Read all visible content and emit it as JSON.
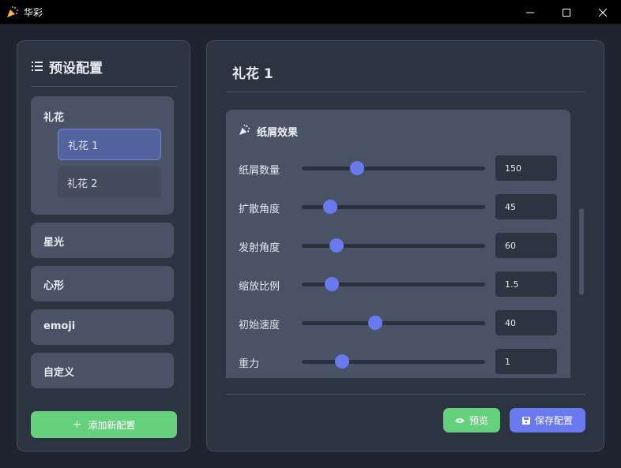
{
  "window": {
    "title": "华彩",
    "icon": "party-popper-icon",
    "controls": [
      "minimize-icon",
      "maximize-icon",
      "close-icon"
    ]
  },
  "sidebar": {
    "title": "预设配置",
    "groups": [
      {
        "label": "礼花",
        "items": [
          {
            "label": "礼花 1",
            "active": true
          },
          {
            "label": "礼花 2",
            "active": false
          }
        ]
      },
      {
        "label": "星光"
      },
      {
        "label": "心形"
      },
      {
        "label": "emoji"
      },
      {
        "label": "自定义"
      }
    ],
    "add_button": "添加新配置"
  },
  "main": {
    "title": "礼花 1",
    "section_title": "纸屑效果",
    "params": [
      {
        "label": "纸屑数量",
        "value": "150",
        "fraction": 0.3
      },
      {
        "label": "扩散角度",
        "value": "45",
        "fraction": 0.155
      },
      {
        "label": "发射角度",
        "value": "60",
        "fraction": 0.19
      },
      {
        "label": "缩放比例",
        "value": "1.5",
        "fraction": 0.165
      },
      {
        "label": "初始速度",
        "value": "40",
        "fraction": 0.4
      },
      {
        "label": "重力",
        "value": "1",
        "fraction": 0.22
      }
    ],
    "preview_button": "预览",
    "save_button": "保存配置"
  },
  "colors": {
    "accent_blue": "#6979ee",
    "accent_green": "#66d17c",
    "panel_bg": "#2c3341",
    "card_bg": "#4a5366"
  }
}
